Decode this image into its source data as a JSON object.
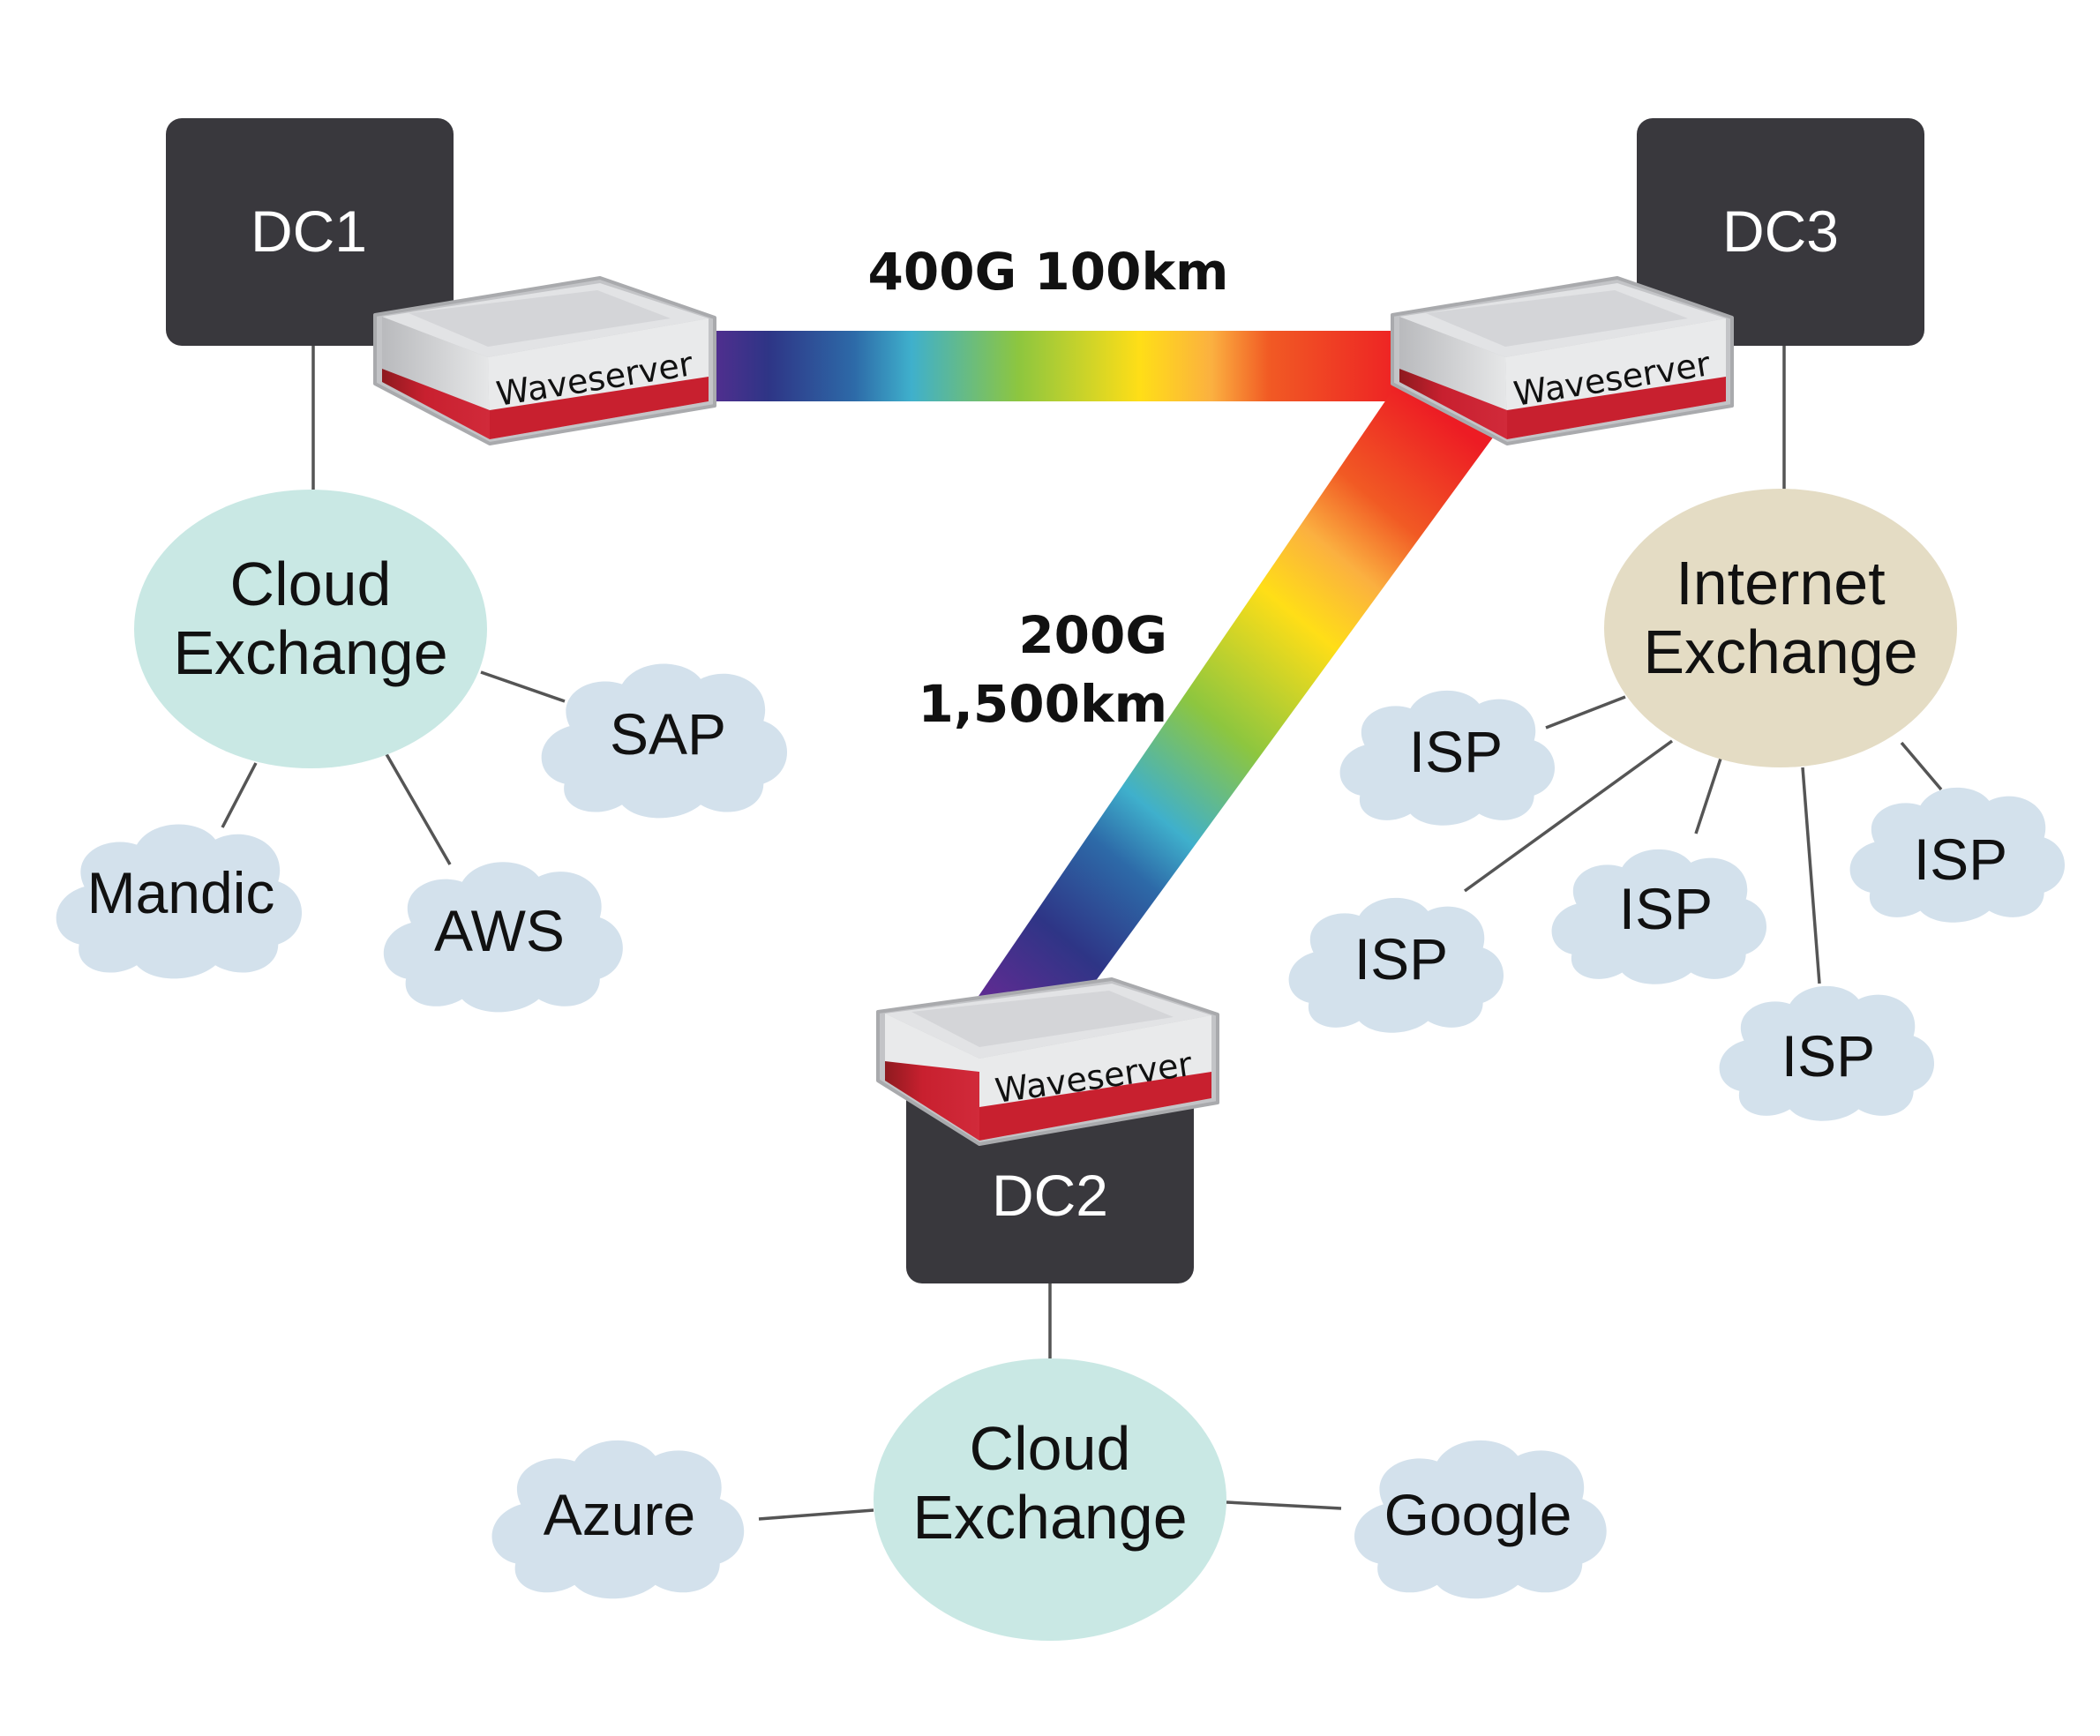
{
  "diagram": {
    "datacenters": [
      {
        "id": "dc1",
        "label": "DC1"
      },
      {
        "id": "dc2",
        "label": "DC2"
      },
      {
        "id": "dc3",
        "label": "DC3"
      }
    ],
    "waveservers": [
      {
        "id": "ws1",
        "label": "Waveserver",
        "attached_to": "DC1"
      },
      {
        "id": "ws2",
        "label": "Waveserver",
        "attached_to": "DC2"
      },
      {
        "id": "ws3",
        "label": "Waveserver",
        "attached_to": "DC3"
      }
    ],
    "links": [
      {
        "id": "dc1-dc3",
        "from": "DC1",
        "to": "DC3",
        "label": "400G 100km",
        "capacity": "400G",
        "distance": "100km"
      },
      {
        "id": "dc3-dc2",
        "from": "DC3",
        "to": "DC2",
        "label_line1": "200G",
        "label_line2": "1,500km",
        "capacity": "200G",
        "distance": "1,500km"
      }
    ],
    "exchanges": [
      {
        "id": "cx1",
        "line1": "Cloud",
        "line2": "Exchange",
        "attached_to": "DC1",
        "color": "#c9e8e4"
      },
      {
        "id": "ix3",
        "line1": "Internet",
        "line2": "Exchange",
        "attached_to": "DC3",
        "color": "#e4dcc4"
      },
      {
        "id": "cx2",
        "line1": "Cloud",
        "line2": "Exchange",
        "attached_to": "DC2",
        "color": "#c9e8e4"
      }
    ],
    "clouds": [
      {
        "id": "sap",
        "label": "SAP",
        "exchange": "cx1"
      },
      {
        "id": "mandic",
        "label": "Mandic",
        "exchange": "cx1"
      },
      {
        "id": "aws",
        "label": "AWS",
        "exchange": "cx1"
      },
      {
        "id": "isp1",
        "label": "ISP",
        "exchange": "ix3"
      },
      {
        "id": "isp2",
        "label": "ISP",
        "exchange": "ix3"
      },
      {
        "id": "isp3",
        "label": "ISP",
        "exchange": "ix3"
      },
      {
        "id": "isp4",
        "label": "ISP",
        "exchange": "ix3"
      },
      {
        "id": "isp5",
        "label": "ISP",
        "exchange": "ix3"
      },
      {
        "id": "azure",
        "label": "Azure",
        "exchange": "cx2"
      },
      {
        "id": "google",
        "label": "Google",
        "exchange": "cx2"
      }
    ],
    "colors": {
      "datacenter": "#39383d",
      "cloud": "#d3e1ec",
      "connector": "#555555",
      "waveserver_red": "#c8202f",
      "spectrum": [
        "#5b2c91",
        "#2e3586",
        "#2d6aa8",
        "#3fb0cc",
        "#8dc63f",
        "#ffde17",
        "#f15a24",
        "#ed1c24"
      ]
    }
  }
}
